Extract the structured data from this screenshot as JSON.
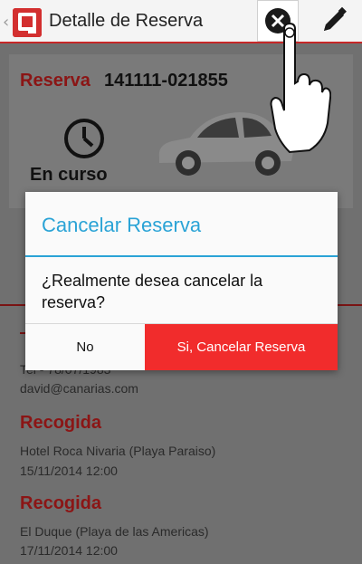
{
  "action_bar": {
    "back_glyph": "‹",
    "title": "Detalle de Reserva",
    "logo_icon": "app-logo-q",
    "close_icon": "close-circle-icon",
    "edit_icon": "pencil-icon"
  },
  "reservation": {
    "label": "Reserva",
    "number": "141111-021855",
    "status": "En curso",
    "status_icon": "clock-icon"
  },
  "customer": {
    "phone": "Tel - 78/07/1983",
    "email": "david@canarias.com"
  },
  "pickups": [
    {
      "heading": "Recogida",
      "place": "Hotel Roca Nivaria (Playa Paraiso)",
      "datetime": "15/11/2014 12:00"
    },
    {
      "heading": "Recogida",
      "place": "El Duque (Playa de las Americas)",
      "datetime": "17/11/2014 12:00"
    }
  ],
  "dialog": {
    "title": "Cancelar Reserva",
    "message": "¿Realmente desea cancelar la reserva?",
    "no_label": "No",
    "yes_label": "Si, Cancelar Reserva"
  },
  "colors": {
    "accent_red": "#f12c2c",
    "dialog_blue": "#2aa3d6",
    "brand_red": "#d32f2f"
  }
}
